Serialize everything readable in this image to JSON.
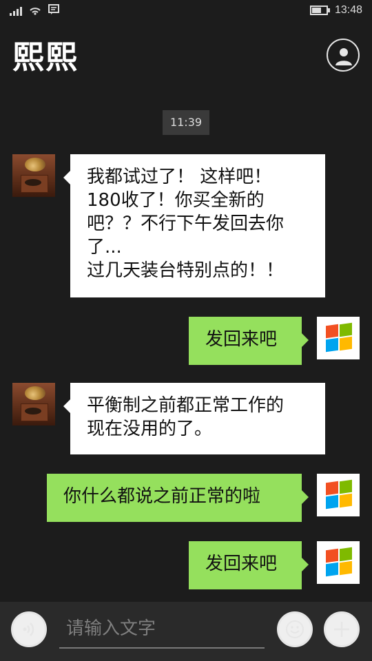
{
  "status_bar": {
    "time": "13:48",
    "icons": [
      "signal-bars-icon",
      "wifi-icon",
      "message-icon",
      "battery-icon"
    ]
  },
  "header": {
    "title": "熙熙",
    "profile_icon": "person-icon"
  },
  "chat": {
    "timestamp": "11:39",
    "messages": [
      {
        "side": "in",
        "avatar": "gramophone-avatar",
        "text": "我都试过了！  这样吧！\n180收了！你买全新的\n吧？？不行下午发回去你\n了...\n过几天装台特别点的！！"
      },
      {
        "side": "out",
        "avatar": "windows-logo-avatar",
        "text": "发回来吧"
      },
      {
        "side": "in",
        "avatar": "gramophone-avatar",
        "text": "平衡制之前都正常工作的\n现在没用的了。"
      },
      {
        "side": "out",
        "avatar": "windows-logo-avatar",
        "text": "你什么都说之前正常的啦"
      },
      {
        "side": "out",
        "avatar": "windows-logo-avatar",
        "text": "发回来吧"
      }
    ]
  },
  "input_bar": {
    "placeholder": "请输入文字",
    "voice_icon": "voice-icon",
    "emoji_icon": "emoji-icon",
    "add_icon": "plus-icon"
  },
  "colors": {
    "background": "#1c1c1c",
    "incoming_bubble": "#ffffff",
    "outgoing_bubble": "#95e05d",
    "input_bar": "#2a2a2a"
  }
}
